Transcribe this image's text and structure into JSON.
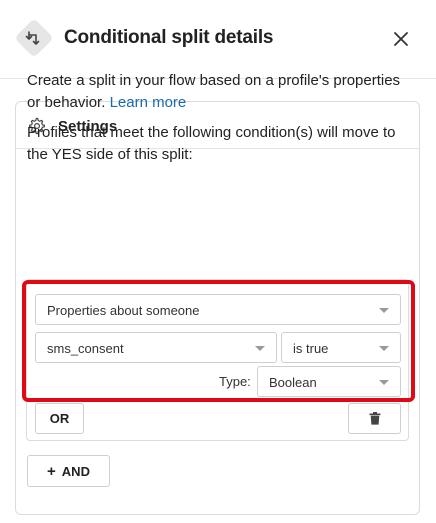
{
  "header": {
    "title": "Conditional split details",
    "split_icon": "split-icon",
    "close_icon": "close-icon"
  },
  "settings": {
    "title": "Settings",
    "icon": "gear-icon",
    "description": "Create a split in your flow based on a profile's properties or behavior.",
    "learn_more": "Learn more",
    "instruction": "Profiles that meet the following condition(s) will move to the YES side of this split:"
  },
  "condition": {
    "property_type": "Properties about someone",
    "field": "sms_consent",
    "operator": "is true",
    "type_label": "Type:",
    "type_value": "Boolean"
  },
  "buttons": {
    "or": "OR",
    "delete_icon": "trash-icon",
    "and": "AND",
    "and_icon": "plus-icon"
  },
  "colors": {
    "highlight": "#e00a17",
    "link": "#1a6bb0",
    "icon_bg": "#e6e6e6"
  }
}
